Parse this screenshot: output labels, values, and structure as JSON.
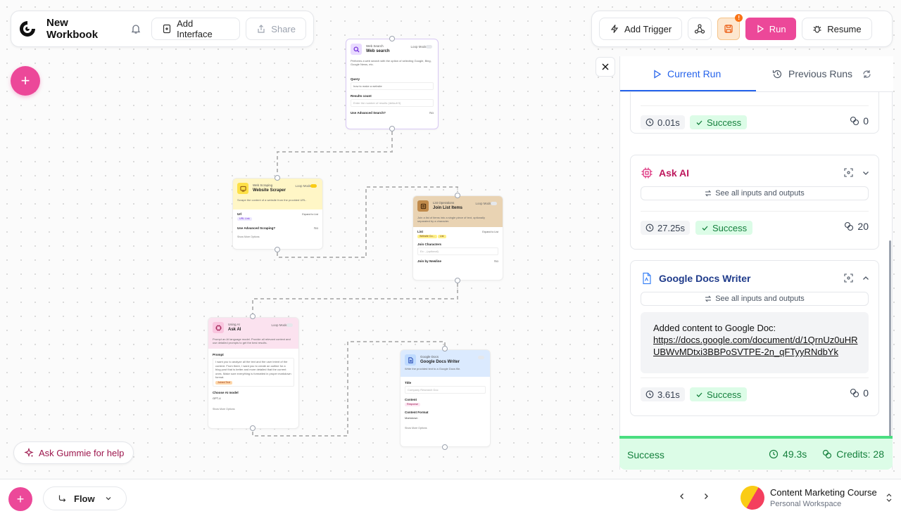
{
  "toolbar": {
    "workbook_title": "New Workbook",
    "add_interface": "Add Interface",
    "share": "Share",
    "add_trigger": "Add Trigger",
    "run": "Run",
    "resume": "Resume",
    "save_badge": "!"
  },
  "canvas": {
    "nodes": {
      "web_search": {
        "category": "Web Search",
        "name": "Web search",
        "loop_mode": "Loop Mode",
        "description": "Performs a web search with the option of selecting Google, Bing, Google News, etc.",
        "query_label": "Query",
        "query_value": "how to make a website",
        "results_label": "Results count",
        "results_placeholder": "Enter the number of results (default 5)",
        "advanced_label": "Use Advanced Search?",
        "advanced_value": "No"
      },
      "website_scraper": {
        "category": "Web Scraping",
        "name": "Website Scraper",
        "loop_mode": "Loop Mode",
        "description": "Scrape the content of a website from the provided URL.",
        "url_label": "Url",
        "expand": "Expand to List",
        "url_pill": "URL Link",
        "advanced_label": "Use Advanced Scraping?",
        "advanced_value": "No",
        "more": "Show More Options"
      },
      "join_list": {
        "category": "List Operations",
        "name": "Join List Items",
        "loop_mode": "Loop Mode",
        "description": "Join a list of items into a single piece of text, optionally separated by a character.",
        "list_label": "List",
        "expand": "Expand to List",
        "list_pill_1": "Website Co...",
        "list_pill_2": "List",
        "join_label": "Join Characters",
        "join_placeholder": "Ex: , (optional)",
        "newline_label": "Join by Newline",
        "newline_value": "No"
      },
      "ask_ai": {
        "category": "Using AI",
        "name": "Ask AI",
        "loop_mode": "Loop Mode",
        "description": "Prompt an AI language model. Provide all relevant context and use detailed prompts to get the best results.",
        "prompt_label": "Prompt",
        "prompt_value": "I want you to analyze all the text and the user intent of the content. From there, I want you to create an outline for a blog post that is better and more detailed that the current ones. Make sure everything is formatted in proper markdown format.",
        "prompt_pill": "Joined Text",
        "model_label": "Choose AI model",
        "model_value": "GPT-4",
        "more": "Show More Options"
      },
      "docs_writer": {
        "category": "Google Docs",
        "name": "Google Docs Writer",
        "description": "Write the provided text to a Google Docs file.",
        "title_label": "Title",
        "title_placeholder": "Company Research Doc",
        "content_label": "Content",
        "content_pill": "Response",
        "format_label": "Content Format",
        "format_value": "Markdown",
        "more": "Show More Options"
      }
    }
  },
  "panel": {
    "tabs": {
      "current": "Current Run",
      "previous": "Previous Runs"
    },
    "steps": [
      {
        "title": "",
        "time": "0.01s",
        "status": "Success",
        "credits": "0"
      },
      {
        "title": "Ask AI",
        "see_all": "See all inputs and outputs",
        "time": "27.25s",
        "status": "Success",
        "credits": "20"
      },
      {
        "title": "Google Docs Writer",
        "see_all": "See all inputs and outputs",
        "output_text": "Added content to Google Doc:",
        "output_link": "https://docs.google.com/document/d/1QrnUz0uHRUBWvMDtxi3BBPoSVTPE-2n_qFTyyRNdbYk",
        "time": "3.61s",
        "status": "Success",
        "credits": "0"
      }
    ],
    "summary": {
      "status": "Success",
      "time": "49.3s",
      "credits": "Credits: 28"
    }
  },
  "help": {
    "ask_label": "Ask Gummie for help"
  },
  "bottom": {
    "flow_label": "Flow",
    "workspace_name": "Content Marketing Course",
    "workspace_sub": "Personal Workspace"
  },
  "colors": {
    "accent": "#ec4899",
    "active_tab": "#2563eb",
    "success": "#15803d",
    "success_bg": "#dcfce7"
  }
}
